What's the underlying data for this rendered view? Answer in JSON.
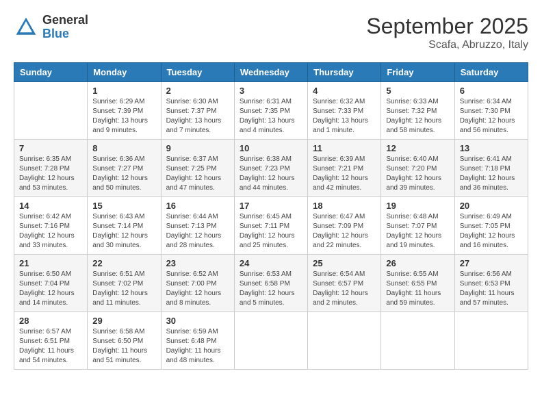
{
  "header": {
    "logo_general": "General",
    "logo_blue": "Blue",
    "month_title": "September 2025",
    "location": "Scafa, Abruzzo, Italy"
  },
  "columns": [
    "Sunday",
    "Monday",
    "Tuesday",
    "Wednesday",
    "Thursday",
    "Friday",
    "Saturday"
  ],
  "weeks": [
    [
      {
        "day": "",
        "info": ""
      },
      {
        "day": "1",
        "info": "Sunrise: 6:29 AM\nSunset: 7:39 PM\nDaylight: 13 hours\nand 9 minutes."
      },
      {
        "day": "2",
        "info": "Sunrise: 6:30 AM\nSunset: 7:37 PM\nDaylight: 13 hours\nand 7 minutes."
      },
      {
        "day": "3",
        "info": "Sunrise: 6:31 AM\nSunset: 7:35 PM\nDaylight: 13 hours\nand 4 minutes."
      },
      {
        "day": "4",
        "info": "Sunrise: 6:32 AM\nSunset: 7:33 PM\nDaylight: 13 hours\nand 1 minute."
      },
      {
        "day": "5",
        "info": "Sunrise: 6:33 AM\nSunset: 7:32 PM\nDaylight: 12 hours\nand 58 minutes."
      },
      {
        "day": "6",
        "info": "Sunrise: 6:34 AM\nSunset: 7:30 PM\nDaylight: 12 hours\nand 56 minutes."
      }
    ],
    [
      {
        "day": "7",
        "info": "Sunrise: 6:35 AM\nSunset: 7:28 PM\nDaylight: 12 hours\nand 53 minutes."
      },
      {
        "day": "8",
        "info": "Sunrise: 6:36 AM\nSunset: 7:27 PM\nDaylight: 12 hours\nand 50 minutes."
      },
      {
        "day": "9",
        "info": "Sunrise: 6:37 AM\nSunset: 7:25 PM\nDaylight: 12 hours\nand 47 minutes."
      },
      {
        "day": "10",
        "info": "Sunrise: 6:38 AM\nSunset: 7:23 PM\nDaylight: 12 hours\nand 44 minutes."
      },
      {
        "day": "11",
        "info": "Sunrise: 6:39 AM\nSunset: 7:21 PM\nDaylight: 12 hours\nand 42 minutes."
      },
      {
        "day": "12",
        "info": "Sunrise: 6:40 AM\nSunset: 7:20 PM\nDaylight: 12 hours\nand 39 minutes."
      },
      {
        "day": "13",
        "info": "Sunrise: 6:41 AM\nSunset: 7:18 PM\nDaylight: 12 hours\nand 36 minutes."
      }
    ],
    [
      {
        "day": "14",
        "info": "Sunrise: 6:42 AM\nSunset: 7:16 PM\nDaylight: 12 hours\nand 33 minutes."
      },
      {
        "day": "15",
        "info": "Sunrise: 6:43 AM\nSunset: 7:14 PM\nDaylight: 12 hours\nand 30 minutes."
      },
      {
        "day": "16",
        "info": "Sunrise: 6:44 AM\nSunset: 7:13 PM\nDaylight: 12 hours\nand 28 minutes."
      },
      {
        "day": "17",
        "info": "Sunrise: 6:45 AM\nSunset: 7:11 PM\nDaylight: 12 hours\nand 25 minutes."
      },
      {
        "day": "18",
        "info": "Sunrise: 6:47 AM\nSunset: 7:09 PM\nDaylight: 12 hours\nand 22 minutes."
      },
      {
        "day": "19",
        "info": "Sunrise: 6:48 AM\nSunset: 7:07 PM\nDaylight: 12 hours\nand 19 minutes."
      },
      {
        "day": "20",
        "info": "Sunrise: 6:49 AM\nSunset: 7:05 PM\nDaylight: 12 hours\nand 16 minutes."
      }
    ],
    [
      {
        "day": "21",
        "info": "Sunrise: 6:50 AM\nSunset: 7:04 PM\nDaylight: 12 hours\nand 14 minutes."
      },
      {
        "day": "22",
        "info": "Sunrise: 6:51 AM\nSunset: 7:02 PM\nDaylight: 12 hours\nand 11 minutes."
      },
      {
        "day": "23",
        "info": "Sunrise: 6:52 AM\nSunset: 7:00 PM\nDaylight: 12 hours\nand 8 minutes."
      },
      {
        "day": "24",
        "info": "Sunrise: 6:53 AM\nSunset: 6:58 PM\nDaylight: 12 hours\nand 5 minutes."
      },
      {
        "day": "25",
        "info": "Sunrise: 6:54 AM\nSunset: 6:57 PM\nDaylight: 12 hours\nand 2 minutes."
      },
      {
        "day": "26",
        "info": "Sunrise: 6:55 AM\nSunset: 6:55 PM\nDaylight: 11 hours\nand 59 minutes."
      },
      {
        "day": "27",
        "info": "Sunrise: 6:56 AM\nSunset: 6:53 PM\nDaylight: 11 hours\nand 57 minutes."
      }
    ],
    [
      {
        "day": "28",
        "info": "Sunrise: 6:57 AM\nSunset: 6:51 PM\nDaylight: 11 hours\nand 54 minutes."
      },
      {
        "day": "29",
        "info": "Sunrise: 6:58 AM\nSunset: 6:50 PM\nDaylight: 11 hours\nand 51 minutes."
      },
      {
        "day": "30",
        "info": "Sunrise: 6:59 AM\nSunset: 6:48 PM\nDaylight: 11 hours\nand 48 minutes."
      },
      {
        "day": "",
        "info": ""
      },
      {
        "day": "",
        "info": ""
      },
      {
        "day": "",
        "info": ""
      },
      {
        "day": "",
        "info": ""
      }
    ]
  ]
}
